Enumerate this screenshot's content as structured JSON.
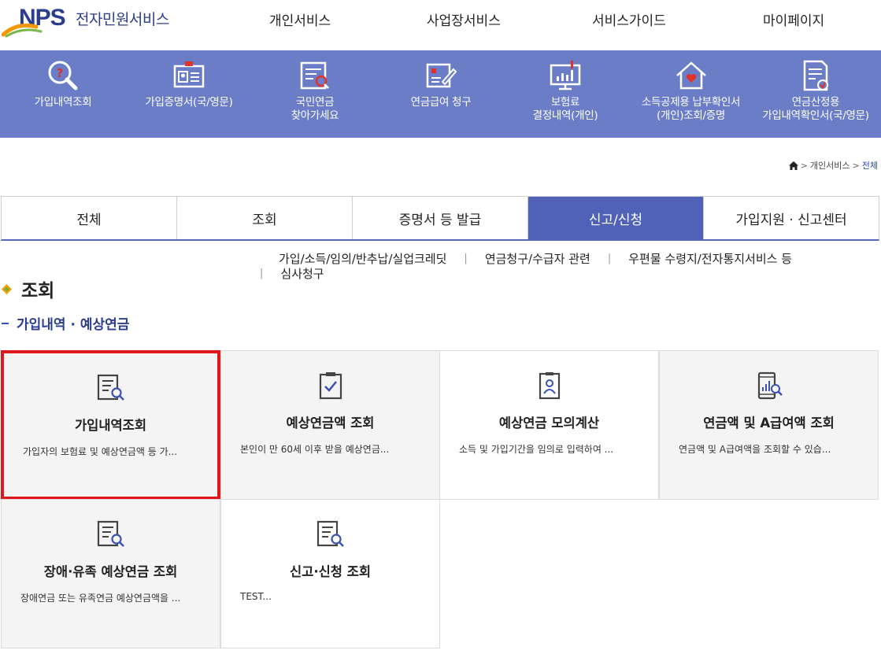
{
  "header": {
    "logo_brand": "NPS",
    "logo_title": "전자민원서비스",
    "nav": [
      "개인서비스",
      "사업장서비스",
      "서비스가이드",
      "마이페이지"
    ]
  },
  "quick_menu": [
    {
      "label": "가입내역조회",
      "icon": "search-question-icon"
    },
    {
      "label": "가입증명서(국/영문)",
      "icon": "id-card-icon"
    },
    {
      "label": "국민연금\n찾아가세요",
      "icon": "document-search-icon"
    },
    {
      "label": "연금급여 청구",
      "icon": "form-pen-icon"
    },
    {
      "label": "보험료\n결정내역(개인)",
      "icon": "monitor-chart-icon"
    },
    {
      "label": "소득공제용 납부확인서\n(개인)조회/증명",
      "icon": "house-heart-icon"
    },
    {
      "label": "연금산정용\n가입내역확인서(국/영문)",
      "icon": "document-check-icon"
    }
  ],
  "breadcrumb": {
    "home_icon": "home-icon",
    "items": [
      "개인서비스",
      "전체"
    ]
  },
  "tabs": [
    {
      "label": "전체",
      "active": false
    },
    {
      "label": "조회",
      "active": false
    },
    {
      "label": "증명서 등 발급",
      "active": false
    },
    {
      "label": "신고/신청",
      "active": true
    },
    {
      "label": "가입지원 · 신고센터",
      "active": false
    }
  ],
  "sublinks": [
    "가입/소득/임의/반추납/실업크레딧",
    "연금청구/수급자 관련",
    "우편물 수령지/전자통지서비스 등",
    "심사청구"
  ],
  "section": {
    "title": "조회",
    "subtitle": "가입내역 · 예상연금"
  },
  "cards": [
    {
      "title": "가입내역조회",
      "desc": "가입자의 보험료 및 예상연금액 등 가...",
      "icon": "document-search-icon"
    },
    {
      "title": "예상연금액 조회",
      "desc": "본인이 만 60세 이후 받을 예상연금...",
      "icon": "clipboard-check-icon"
    },
    {
      "title": "예상연금 모의계산",
      "desc": "소득 및 가입기간을 임의로 입력하여 ...",
      "icon": "clipboard-user-icon"
    },
    {
      "title": "연금액 및 A급여액 조회",
      "desc": "연금액 및 A급여액을 조회할 수 있습...",
      "icon": "phone-chart-icon"
    },
    {
      "title": "장애·유족 예상연금 조회",
      "desc": "장애연금 또는 유족연금 예상연금액을 ...",
      "icon": "document-search-icon"
    },
    {
      "title": "신고·신청 조회",
      "desc": "TEST...",
      "icon": "document-search-icon"
    }
  ],
  "colors": {
    "band": "#6b7dc7",
    "active_tab": "#4f62b8",
    "brand": "#2b3d8f",
    "highlight": "#e0161b",
    "diamond_a": "#f5a100",
    "diamond_b": "#6bb33f"
  }
}
